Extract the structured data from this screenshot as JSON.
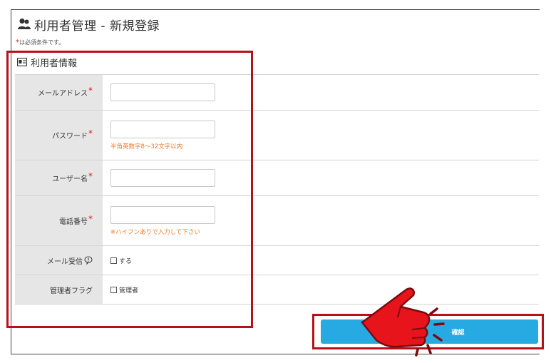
{
  "page": {
    "title": "利用者管理 - 新規登録",
    "required_star": "*",
    "required_note": "は必須条件です。"
  },
  "section": {
    "title": "利用者情報"
  },
  "fields": {
    "email": {
      "label": "メールアドレス",
      "star": "*",
      "value": ""
    },
    "password": {
      "label": "パスワード",
      "star": "*",
      "value": "",
      "hint": "半角英数字8～32文字以内"
    },
    "username": {
      "label": "ユーザー名",
      "star": "*",
      "value": ""
    },
    "phone": {
      "label": "電話番号",
      "star": "*",
      "value": "",
      "hint": "※ハイフンありで入力して下さい"
    },
    "mail_receive": {
      "label": "メール受信",
      "checkbox_label": "する",
      "checked": false
    },
    "admin_flag": {
      "label": "管理者フラグ",
      "checkbox_label": "管理者",
      "checked": false
    }
  },
  "actions": {
    "confirm_label": "確認"
  },
  "colors": {
    "required": "#e0191b",
    "hint": "#f07a2a",
    "button": "#27a9e1",
    "annotation": "#b5111b",
    "pointer_hand": "#e8141b"
  }
}
